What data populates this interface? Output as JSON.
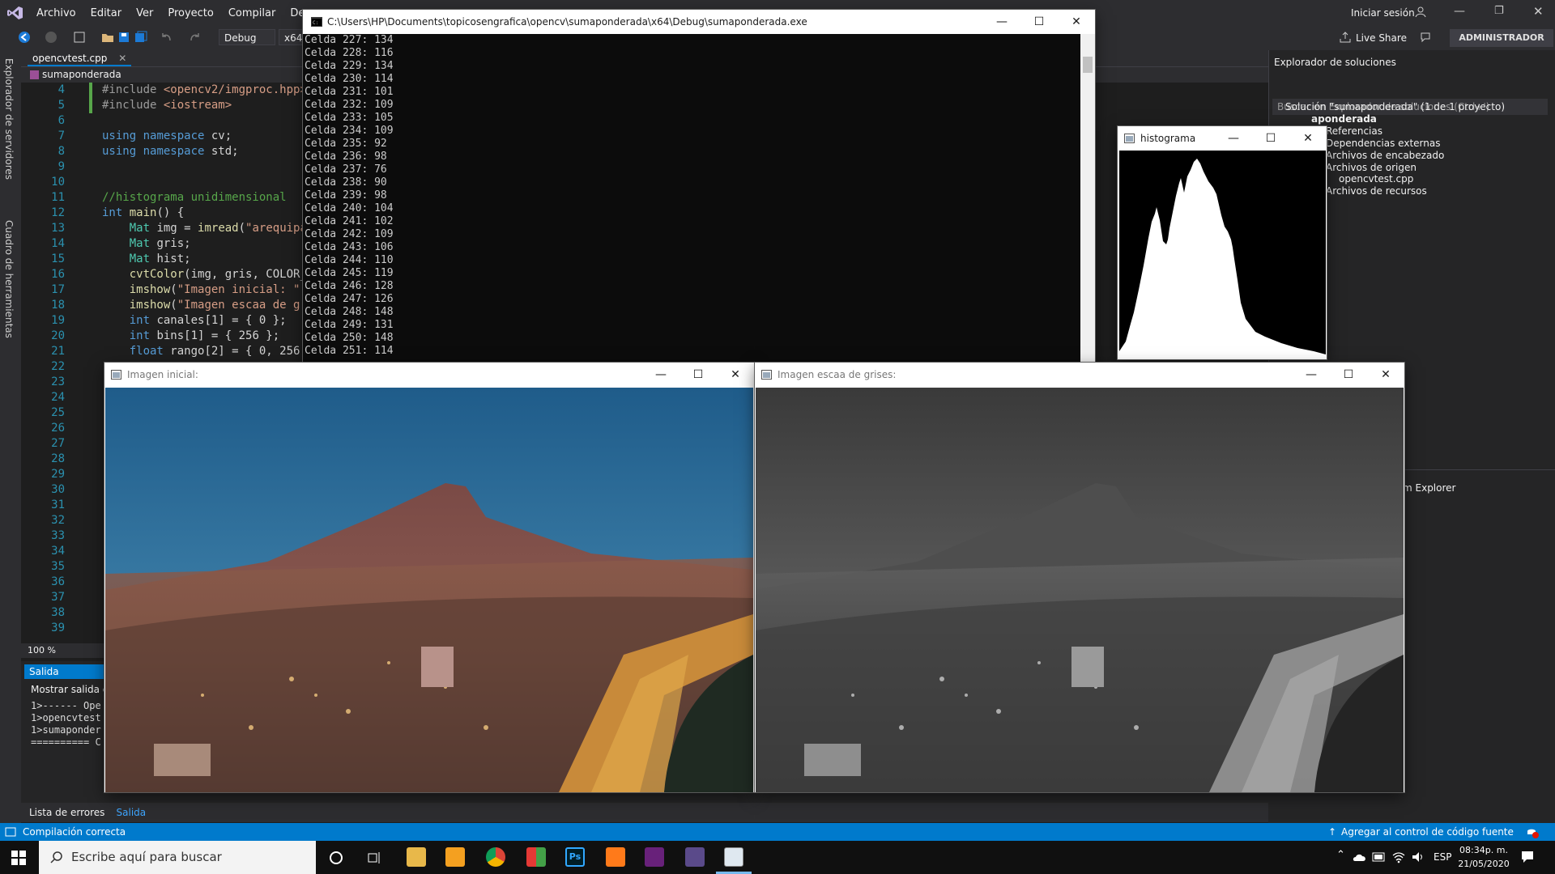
{
  "vs": {
    "menu": [
      "Archivo",
      "Editar",
      "Ver",
      "Proyecto",
      "Compilar",
      "Depurar"
    ],
    "config": "Debug",
    "platform": "x64",
    "signin": "Iniciar sesión",
    "liveshare": "Live Share",
    "admin": "ADMINISTRADOR",
    "side_tabs": [
      "Explorador de servidores",
      "Cuadro de herramientas"
    ],
    "file_tab": "opencvtest.cpp",
    "nav_scope": "sumaponderada",
    "zoom": "100 %",
    "status": "Compilación correcta",
    "source_control": "Agregar al control de código fuente",
    "code_lines": [
      {
        "n": "4",
        "html": "<span class='pp'>#include</span> <span class='inc'>&lt;opencv2/imgproc.hpp&gt;</span>"
      },
      {
        "n": "5",
        "html": "<span class='pp'>#include</span> <span class='inc'>&lt;iostream&gt;</span>"
      },
      {
        "n": "6",
        "html": ""
      },
      {
        "n": "7",
        "html": "<span class='kw'>using</span> <span class='kw'>namespace</span> cv;"
      },
      {
        "n": "8",
        "html": "<span class='kw'>using</span> <span class='kw'>namespace</span> std;"
      },
      {
        "n": "9",
        "html": ""
      },
      {
        "n": "10",
        "html": ""
      },
      {
        "n": "11",
        "html": "<span class='cm'>//histograma unidimensional</span>"
      },
      {
        "n": "12",
        "html": "<span class='kw'>int</span> <span class='fn'>main</span>() {"
      },
      {
        "n": "13",
        "html": "    <span class='ty'>Mat</span> img = <span class='fn'>imread</span>(<span class='str'>\"arequipa.</span>"
      },
      {
        "n": "14",
        "html": "    <span class='ty'>Mat</span> gris;"
      },
      {
        "n": "15",
        "html": "    <span class='ty'>Mat</span> hist;"
      },
      {
        "n": "16",
        "html": "    <span class='fn'>cvtColor</span>(img, gris, COLOR_R"
      },
      {
        "n": "17",
        "html": "    <span class='fn'>imshow</span>(<span class='str'>\"Imagen inicial: \"</span>,"
      },
      {
        "n": "18",
        "html": "    <span class='fn'>imshow</span>(<span class='str'>\"Imagen escaa de gri</span>"
      },
      {
        "n": "19",
        "html": "    <span class='kw'>int</span> canales[1] = { 0 };"
      },
      {
        "n": "20",
        "html": "    <span class='kw'>int</span> bins[1] = { 256 };"
      },
      {
        "n": "21",
        "html": "    <span class='kw'>float</span> rango[2] = { 0, 256 }"
      },
      {
        "n": "22",
        "html": ""
      },
      {
        "n": "23",
        "html": ""
      },
      {
        "n": "24",
        "html": ""
      },
      {
        "n": "25",
        "html": ""
      },
      {
        "n": "26",
        "html": ""
      },
      {
        "n": "27",
        "html": ""
      },
      {
        "n": "28",
        "html": ""
      },
      {
        "n": "29",
        "html": ""
      },
      {
        "n": "30",
        "html": ""
      },
      {
        "n": "31",
        "html": ""
      },
      {
        "n": "32",
        "html": ""
      },
      {
        "n": "33",
        "html": ""
      },
      {
        "n": "34",
        "html": ""
      },
      {
        "n": "35",
        "html": ""
      },
      {
        "n": "36",
        "html": ""
      },
      {
        "n": "37",
        "html": ""
      },
      {
        "n": "38",
        "html": ""
      },
      {
        "n": "39",
        "html": ""
      }
    ],
    "output": {
      "tab": "Salida",
      "show": "Mostrar salida de",
      "lines": [
        "1>------ Ope",
        "1>opencvtest",
        "1>sumaponder",
        "========== C"
      ]
    },
    "bottom_tabs": [
      "Lista de errores",
      "Salida"
    ],
    "solution": {
      "title": "Explorador de soluciones",
      "search": "Buscar en Explorador de soluciones (Ctrl+')",
      "items": [
        "Solución \"sumaponderada\" (1 de 1 proyecto)",
        "aponderada",
        "Referencias",
        "Dependencias externas",
        "Archivos de encabezado",
        "Archivos de origen",
        "opencvtest.cpp",
        "Archivos de recursos"
      ],
      "team_explorer": "m Explorer"
    }
  },
  "console": {
    "title": "C:\\Users\\HP\\Documents\\topicosengrafica\\opencv\\sumaponderada\\x64\\Debug\\sumaponderada.exe",
    "lines": [
      "Celda 227: 134",
      "Celda 228: 116",
      "Celda 229: 134",
      "Celda 230: 114",
      "Celda 231: 101",
      "Celda 232: 109",
      "Celda 233: 105",
      "Celda 234: 109",
      "Celda 235: 92",
      "Celda 236: 98",
      "Celda 237: 76",
      "Celda 238: 90",
      "Celda 239: 98",
      "Celda 240: 104",
      "Celda 241: 102",
      "Celda 242: 109",
      "Celda 243: 106",
      "Celda 244: 110",
      "Celda 245: 119",
      "Celda 246: 128",
      "Celda 247: 126",
      "Celda 248: 148",
      "Celda 249: 131",
      "Celda 250: 148",
      "Celda 251: 114"
    ]
  },
  "windows": {
    "hist": "histograma",
    "img1": "Imagen inicial:",
    "img2": "Imagen escaa de grises:"
  },
  "taskbar": {
    "search": "Escribe aquí para buscar",
    "lang": "ESP",
    "time": "08:34p. m.",
    "date": "21/05/2020"
  },
  "colors": {
    "accent": "#007acc",
    "vs_purple": "#68217a"
  }
}
